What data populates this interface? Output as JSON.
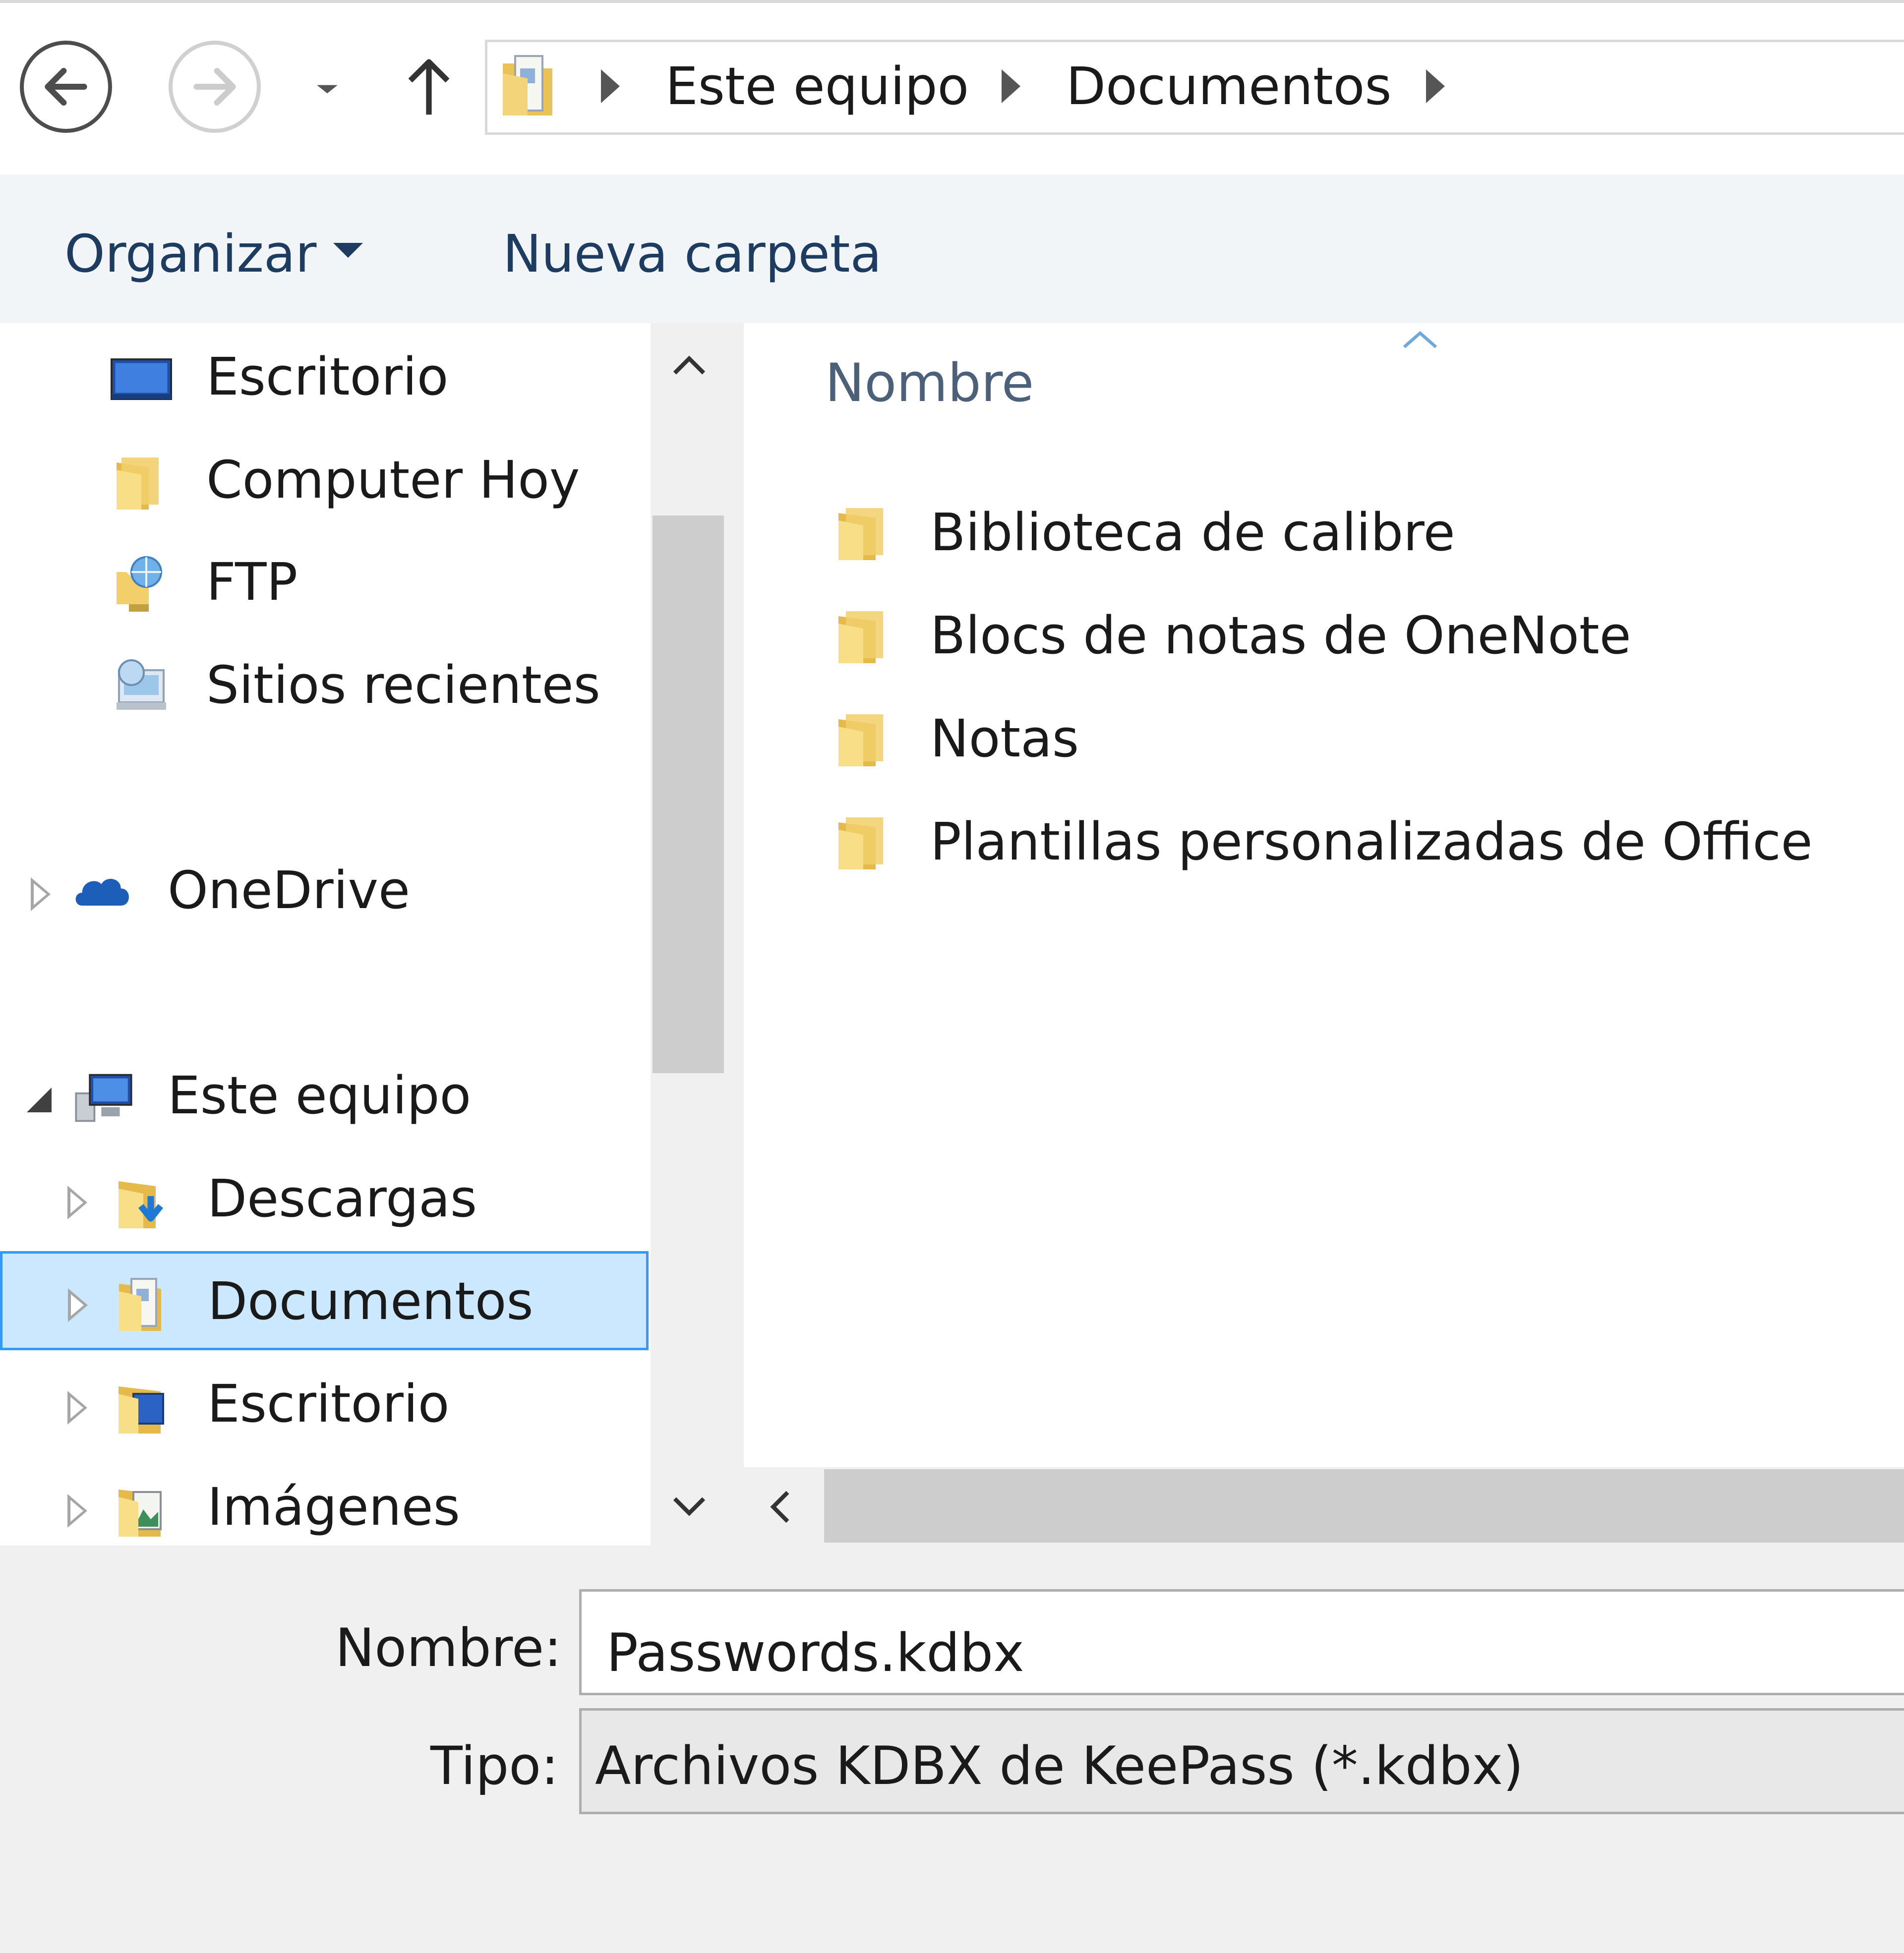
{
  "navigation": {
    "back_icon": "arrow-left-icon",
    "forward_icon": "arrow-right-icon",
    "recent_icon": "chevron-down-icon",
    "up_icon": "arrow-up-icon"
  },
  "address_bar": {
    "folder_icon": "documents-folder-icon",
    "crumbs": [
      "Este equipo",
      "Documentos"
    ]
  },
  "toolbar": {
    "organize_label": "Organizar",
    "new_folder_label": "Nueva carpeta"
  },
  "nav_pane": {
    "items": [
      {
        "label": "Escritorio",
        "icon": "desktop-icon"
      },
      {
        "label": "Computer Hoy",
        "icon": "folder-icon"
      },
      {
        "label": "FTP",
        "icon": "ftp-icon"
      },
      {
        "label": "Sitios recientes",
        "icon": "recent-places-icon"
      },
      {
        "label": "OneDrive",
        "icon": "onedrive-cloud-icon"
      },
      {
        "label": "Este equipo",
        "icon": "computer-icon"
      },
      {
        "label": "Descargas",
        "icon": "downloads-folder-icon"
      },
      {
        "label": "Documentos",
        "icon": "documents-folder-icon",
        "selected": true
      },
      {
        "label": "Escritorio",
        "icon": "desktop-folder-icon"
      },
      {
        "label": "Imágenes",
        "icon": "pictures-folder-icon"
      }
    ]
  },
  "file_list": {
    "column_header": "Nombre",
    "sort_direction": "ascending",
    "items": [
      {
        "name": "Biblioteca de calibre",
        "icon": "folder-icon"
      },
      {
        "name": "Blocs de notas de OneNote",
        "icon": "folder-icon"
      },
      {
        "name": "Notas",
        "icon": "folder-icon"
      },
      {
        "name": "Plantillas personalizadas de Office",
        "icon": "folder-icon"
      }
    ]
  },
  "form": {
    "name_label": "Nombre:",
    "name_value": "Passwords.kdbx",
    "type_label": "Tipo:",
    "type_value": "Archivos KDBX de KeePass (*.kdbx)"
  },
  "colors": {
    "selection_bg": "#cce8ff",
    "selection_border": "#3399ff",
    "toolbar_text": "#1e3c60",
    "header_text": "#4c607a",
    "folder_yellow": "#f5d46b"
  }
}
